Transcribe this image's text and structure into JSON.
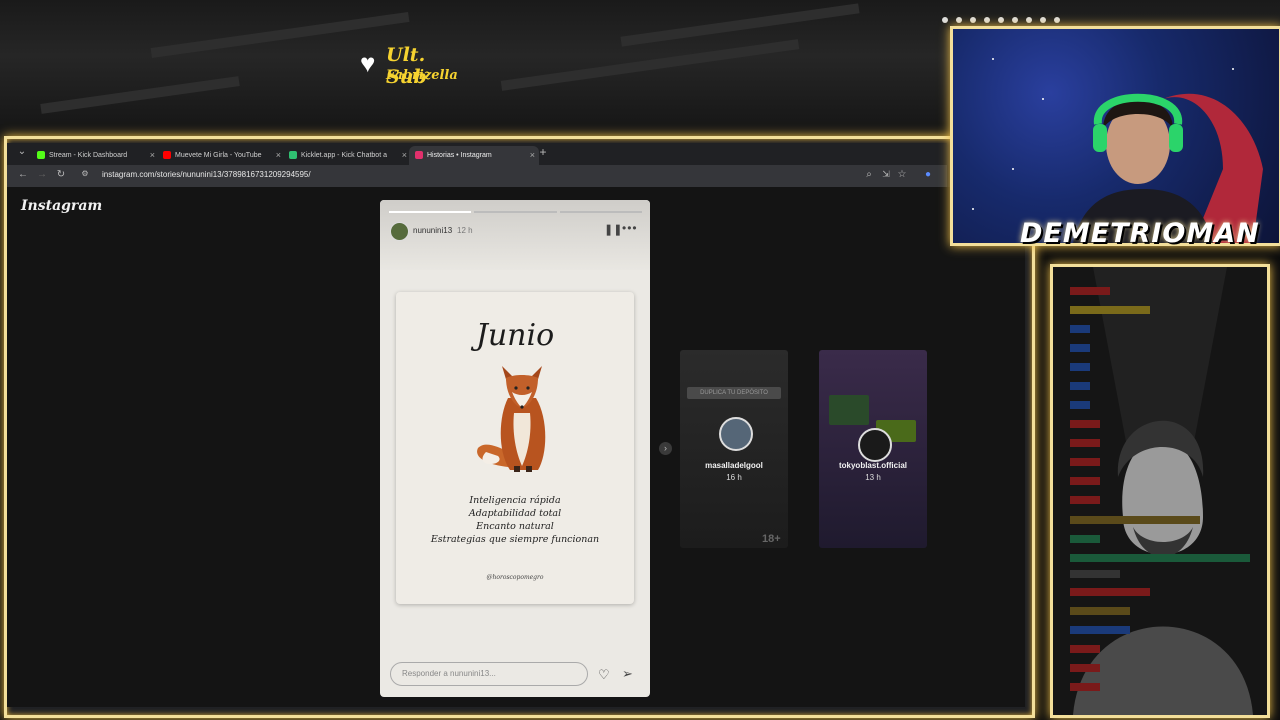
{
  "overlay": {
    "sub_label": "Ult. Sub",
    "sub_name": "Fabrizella",
    "streamer_name": "DEMETRIOMAN"
  },
  "browser": {
    "tabs": [
      {
        "label": "Stream - Kick Dashboard",
        "favicon_color": "#53fc18",
        "active": false
      },
      {
        "label": "Muevete Mi Girla - YouTube",
        "favicon_color": "#ff0000",
        "active": false
      },
      {
        "label": "Kicklet.app - Kick Chatbot a",
        "favicon_color": "#2fbf71",
        "active": false
      },
      {
        "label": "Historias • Instagram",
        "favicon_color": "#e1306c",
        "active": true
      }
    ],
    "new_tab": "+",
    "url": "instagram.com/stories/nununini13/3789816731209294595/"
  },
  "instagram": {
    "logo": "Instagram",
    "story": {
      "username": "nununini13",
      "time": "12 h",
      "progress": [
        1.0,
        0.0,
        0.0
      ],
      "card_title": "Junio",
      "traits": [
        "Inteligencia rápida",
        "Adaptabilidad total",
        "Encanto natural",
        "Estrategias que siempre funcionan"
      ],
      "handle": "@horoscopomegro",
      "reply_placeholder": "Responder a nununini13..."
    },
    "previews": [
      {
        "username": "masalladelgool",
        "time": "16 h",
        "badge": "18+",
        "banner": "DUPLICA TU DEPÓSITO"
      },
      {
        "username": "tokyoblast.official",
        "time": "13 h"
      }
    ]
  },
  "colors": {
    "frame_gold": "#f3df9a",
    "sub_text": "#f6d330"
  }
}
